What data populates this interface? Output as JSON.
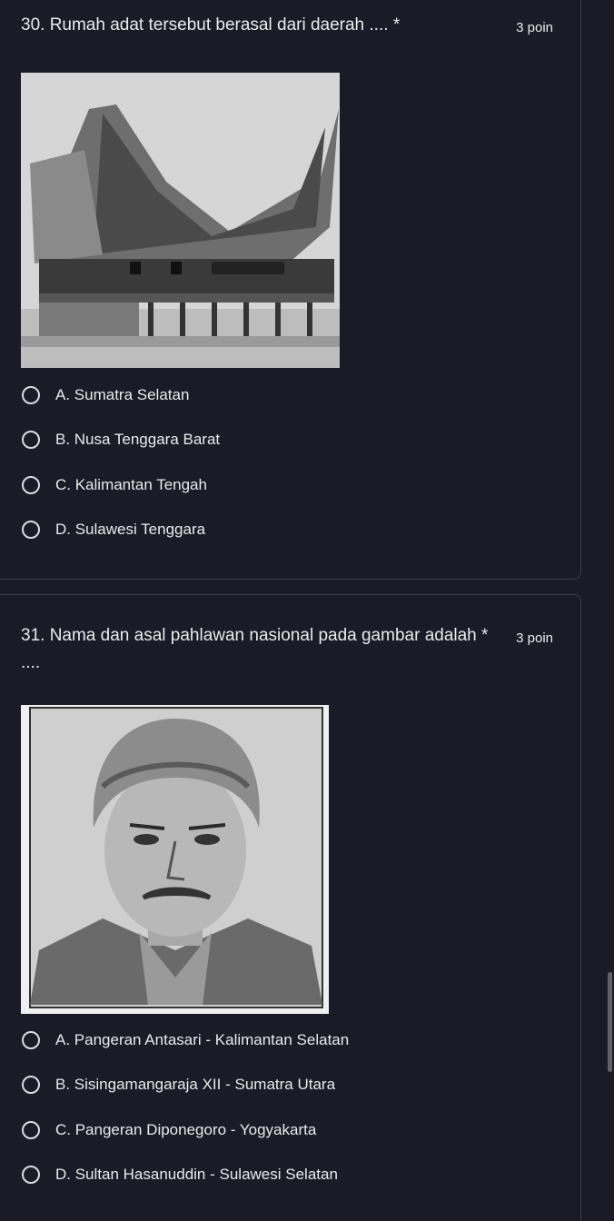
{
  "questions": [
    {
      "title": "30. Rumah adat tersebut berasal dari daerah ....",
      "required_mark": "*",
      "points": "3 poin",
      "image_icon": "traditional-house-photo",
      "options": [
        "A. Sumatra Selatan",
        "B. Nusa Tenggara Barat",
        "C. Kalimantan Tengah",
        "D. Sulawesi Tenggara"
      ]
    },
    {
      "title": "31.  Nama dan asal pahlawan nasional pada gambar adalah",
      "title_cont": "....",
      "required_mark": "*",
      "points": "3 poin",
      "image_icon": "national-hero-portrait",
      "options": [
        "A. Pangeran Antasari - Kalimantan Selatan",
        "B. Sisingamangaraja XII - Sumatra Utara",
        "C. Pangeran Diponegoro - Yogyakarta",
        "D. Sultan Hasanuddin - Sulawesi Selatan"
      ]
    }
  ]
}
